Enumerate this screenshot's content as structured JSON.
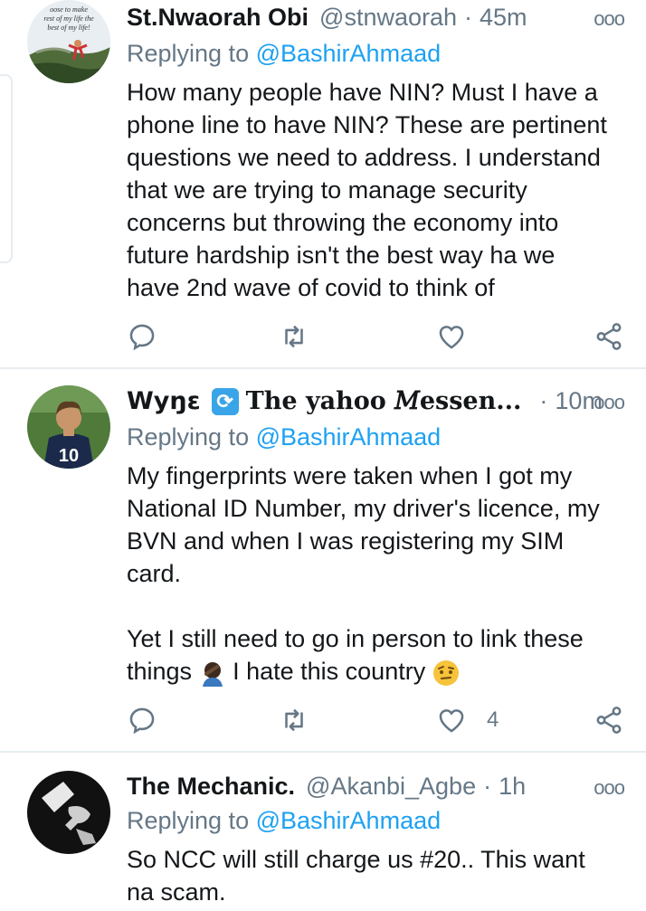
{
  "tweets": [
    {
      "name": "St.Nwaorah Obi",
      "handle": "@stnwaorah",
      "time": "45m",
      "replying_prefix": "Replying to",
      "replying_to": "@BashirAhmaad",
      "body": [
        "How many people have NIN? Must I have a",
        "phone line to have NIN? These are pertinent",
        "questions we need to address. I understand",
        "that we are trying to manage security",
        "concerns but throwing the economy into",
        "future hardship isn't the best way ha we",
        "have 2nd wave of covid to think of"
      ],
      "avatar_text": [
        "oose to make",
        "rest of my life the",
        "best of my life!"
      ],
      "like_count": ""
    },
    {
      "name_part1": "Wyŋɛ",
      "name_part2": "The yahoo 𝑀essen...",
      "badge_icon": "repeat-badge-icon",
      "time": "10m",
      "replying_prefix": "Replying to",
      "replying_to": "@BashirAhmaad",
      "body": [
        "My fingerprints were taken when I got my",
        "National ID Number, my driver's licence, my",
        "BVN and when I was registering my SIM",
        "card.",
        "",
        "Yet I still need to go in person to link these"
      ],
      "body_last_a": "things",
      "body_last_b": " I hate this country ",
      "avatar_jersey": "10",
      "like_count": "4"
    },
    {
      "name": "The Mechanic.",
      "handle": "@Akanbi_Agbe",
      "time": "1h",
      "replying_prefix": "Replying to",
      "replying_to": "@BashirAhmaad",
      "body": [
        "So NCC will still charge us #20.. This want",
        "na scam."
      ]
    }
  ],
  "ui": {
    "more_glyph": "ooo",
    "dot": "·"
  },
  "colors": {
    "text": "#14171a",
    "secondary": "#657786",
    "link": "#1da1f2",
    "divider": "#e6ecf0"
  }
}
